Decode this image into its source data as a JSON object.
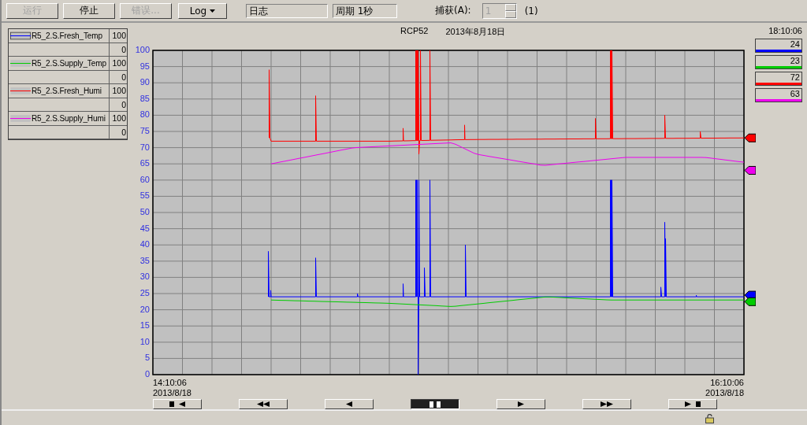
{
  "toolbar": {
    "buttons": [
      {
        "label": "运行",
        "disabled": true
      },
      {
        "label": "停止",
        "disabled": false
      },
      {
        "label": "错误...",
        "disabled": true
      }
    ],
    "log_dropdown": {
      "label": "Log"
    },
    "fields": [
      "日志",
      "周期 1秒"
    ],
    "capture": {
      "label": "捕获(A):",
      "value": "1",
      "disabled": true,
      "count": "(1)"
    }
  },
  "legend": [
    {
      "name": "R5_2.S.Fresh_Temp",
      "color": "#0000ff",
      "max": "100",
      "min": "0",
      "current": "24",
      "selected": true
    },
    {
      "name": "R5_2.S.Supply_Temp",
      "color": "#00cc00",
      "max": "100",
      "min": "0",
      "current": "23",
      "selected": false
    },
    {
      "name": "R5_2.S.Fresh_Humi",
      "color": "#ff0000",
      "max": "100",
      "min": "0",
      "current": "72",
      "selected": false
    },
    {
      "name": "R5_2.S.Supply_Humi",
      "color": "#ee00ee",
      "max": "100",
      "min": "0",
      "current": "63",
      "selected": false
    }
  ],
  "chart": {
    "title": "RCP52",
    "date": "2013年8月18日",
    "current_time": "18:10:06",
    "yticks": [
      "100",
      "95",
      "90",
      "85",
      "80",
      "75",
      "70",
      "65",
      "60",
      "55",
      "50",
      "45",
      "40",
      "35",
      "30",
      "25",
      "20",
      "15",
      "10",
      "5",
      "0"
    ],
    "start_time": "14:10:06",
    "start_date": "2013/8/18",
    "end_time": "16:10:06",
    "end_date": "2013/8/18"
  },
  "nav_buttons": [
    {
      "kind": "first",
      "selected": false
    },
    {
      "kind": "fast-back",
      "selected": false
    },
    {
      "kind": "back",
      "selected": false
    },
    {
      "kind": "pause",
      "selected": true
    },
    {
      "kind": "forward",
      "selected": false
    },
    {
      "kind": "fast-forward",
      "selected": false
    },
    {
      "kind": "last",
      "selected": false
    }
  ]
}
